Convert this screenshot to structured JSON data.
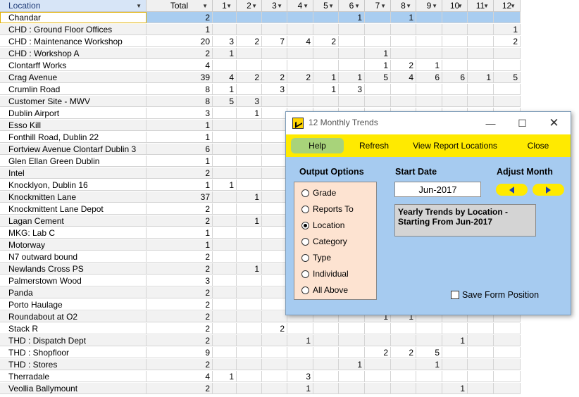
{
  "grid": {
    "columns": [
      "Location",
      "Total",
      "1",
      "2",
      "3",
      "4",
      "5",
      "6",
      "7",
      "8",
      "9",
      "10",
      "11",
      "12"
    ],
    "rows": [
      {
        "location": "Chandar",
        "total": "2",
        "m": [
          "",
          "",
          "",
          "",
          "",
          "1",
          "",
          "1",
          "",
          "",
          "",
          ""
        ]
      },
      {
        "location": "CHD : Ground Floor Offices",
        "total": "1",
        "m": [
          "",
          "",
          "",
          "",
          "",
          "",
          "",
          "",
          "",
          "",
          "",
          "1"
        ]
      },
      {
        "location": "CHD : Maintenance Workshop",
        "total": "20",
        "m": [
          "3",
          "2",
          "7",
          "4",
          "2",
          "",
          "",
          "",
          "",
          "",
          "",
          "2"
        ]
      },
      {
        "location": "CHD : Workshop A",
        "total": "2",
        "m": [
          "1",
          "",
          "",
          "",
          "",
          "",
          "1",
          "",
          "",
          "",
          "",
          ""
        ]
      },
      {
        "location": "Clontarff Works",
        "total": "4",
        "m": [
          "",
          "",
          "",
          "",
          "",
          "",
          "1",
          "2",
          "1",
          "",
          "",
          ""
        ]
      },
      {
        "location": "Crag Avenue",
        "total": "39",
        "m": [
          "4",
          "2",
          "2",
          "2",
          "1",
          "1",
          "5",
          "4",
          "6",
          "6",
          "1",
          "5"
        ]
      },
      {
        "location": "Crumlin Road",
        "total": "8",
        "m": [
          "1",
          "",
          "3",
          "",
          "1",
          "3",
          "",
          "",
          "",
          "",
          "",
          ""
        ]
      },
      {
        "location": "Customer Site - MWV",
        "total": "8",
        "m": [
          "5",
          "3",
          "",
          "",
          "",
          "",
          "",
          "",
          "",
          "",
          "",
          ""
        ]
      },
      {
        "location": "Dublin Airport",
        "total": "3",
        "m": [
          "",
          "1",
          "",
          "",
          "",
          "",
          "",
          "",
          "",
          "",
          "",
          ""
        ]
      },
      {
        "location": "Esso Kill",
        "total": "1",
        "m": [
          "",
          "",
          "",
          "",
          "",
          "",
          "",
          "",
          "",
          "",
          "",
          ""
        ]
      },
      {
        "location": "Fonthill Road, Dublin 22",
        "total": "1",
        "m": [
          "",
          "",
          "",
          "",
          "",
          "",
          "",
          "",
          "",
          "",
          "",
          ""
        ]
      },
      {
        "location": "Fortview Avenue Clontarf Dublin 3",
        "total": "6",
        "m": [
          "",
          "",
          "",
          "",
          "",
          "",
          "",
          "",
          "",
          "",
          "",
          ""
        ]
      },
      {
        "location": "Glen Ellan Green Dublin",
        "total": "1",
        "m": [
          "",
          "",
          "",
          "",
          "",
          "",
          "",
          "",
          "",
          "",
          "",
          ""
        ]
      },
      {
        "location": "Intel",
        "total": "2",
        "m": [
          "",
          "",
          "",
          "",
          "",
          "",
          "",
          "",
          "",
          "",
          "",
          ""
        ]
      },
      {
        "location": "Knocklyon, Dublin 16",
        "total": "1",
        "m": [
          "1",
          "",
          "",
          "",
          "",
          "",
          "",
          "",
          "",
          "",
          "",
          ""
        ]
      },
      {
        "location": "Knockmitten Lane",
        "total": "37",
        "m": [
          "",
          "1",
          "",
          "",
          "",
          "",
          "",
          "",
          "",
          "",
          "",
          ""
        ]
      },
      {
        "location": "Knockmittent Lane Depot",
        "total": "2",
        "m": [
          "",
          "",
          "",
          "",
          "",
          "",
          "",
          "",
          "",
          "",
          "",
          ""
        ]
      },
      {
        "location": "Lagan Cement",
        "total": "2",
        "m": [
          "",
          "1",
          "",
          "",
          "",
          "",
          "",
          "",
          "",
          "",
          "",
          ""
        ]
      },
      {
        "location": "MKG: Lab C",
        "total": "1",
        "m": [
          "",
          "",
          "",
          "",
          "",
          "",
          "",
          "",
          "",
          "",
          "",
          ""
        ]
      },
      {
        "location": "Motorway",
        "total": "1",
        "m": [
          "",
          "",
          "",
          "",
          "",
          "",
          "",
          "",
          "",
          "",
          "",
          ""
        ]
      },
      {
        "location": "N7 outward bound",
        "total": "2",
        "m": [
          "",
          "",
          "",
          "",
          "",
          "",
          "",
          "",
          "",
          "",
          "",
          ""
        ]
      },
      {
        "location": "Newlands Cross PS",
        "total": "2",
        "m": [
          "",
          "1",
          "",
          "",
          "",
          "",
          "",
          "",
          "",
          "",
          "",
          ""
        ]
      },
      {
        "location": "Palmerstown Wood",
        "total": "3",
        "m": [
          "",
          "",
          "",
          "",
          "",
          "",
          "",
          "",
          "",
          "",
          "",
          ""
        ]
      },
      {
        "location": "Panda",
        "total": "2",
        "m": [
          "",
          "",
          "",
          "",
          "",
          "",
          "",
          "",
          "",
          "",
          "",
          ""
        ]
      },
      {
        "location": "Porto Haulage",
        "total": "2",
        "m": [
          "",
          "",
          "",
          "",
          "",
          "",
          "",
          "",
          "",
          "",
          "",
          ""
        ]
      },
      {
        "location": "Roundabout at O2",
        "total": "2",
        "m": [
          "",
          "",
          "",
          "",
          "",
          "",
          "1",
          "1",
          "",
          "",
          "",
          ""
        ]
      },
      {
        "location": "Stack R",
        "total": "2",
        "m": [
          "",
          "",
          "2",
          "",
          "",
          "",
          "",
          "",
          "",
          "",
          "",
          ""
        ]
      },
      {
        "location": "THD : Dispatch Dept",
        "total": "2",
        "m": [
          "",
          "",
          "",
          "1",
          "",
          "",
          "",
          "",
          "",
          "1",
          "",
          ""
        ]
      },
      {
        "location": "THD : Shopfloor",
        "total": "9",
        "m": [
          "",
          "",
          "",
          "",
          "",
          "",
          "2",
          "2",
          "5",
          "",
          "",
          ""
        ]
      },
      {
        "location": "THD : Stores",
        "total": "2",
        "m": [
          "",
          "",
          "",
          "",
          "",
          "1",
          "",
          "",
          "1",
          "",
          "",
          ""
        ]
      },
      {
        "location": "Therradale",
        "total": "4",
        "m": [
          "1",
          "",
          "",
          "3",
          "",
          "",
          "",
          "",
          "",
          "",
          "",
          ""
        ]
      },
      {
        "location": "Veollia Ballymount",
        "total": "2",
        "m": [
          "",
          "",
          "",
          "1",
          "",
          "",
          "",
          "",
          "",
          "1",
          "",
          ""
        ]
      }
    ]
  },
  "dialog": {
    "title": "12 Monthly Trends",
    "toolbar": {
      "help": "Help",
      "refresh": "Refresh",
      "view": "View Report Locations",
      "close": "Close"
    },
    "output_options_label": "Output Options",
    "options": [
      "Grade",
      "Reports To",
      "Location",
      "Category",
      "Type",
      "Individual",
      "All Above"
    ],
    "selected_option": "Location",
    "start_date_label": "Start Date",
    "start_date": "Jun-2017",
    "adjust_month_label": "Adjust Month",
    "description": "Yearly Trends by Location - Starting From Jun-2017",
    "save_position_label": "Save Form Position"
  },
  "colors": {
    "toolbar": "#ffea00",
    "help_button": "#a8d37a",
    "dialog_bg": "#a6cbf0",
    "options_bg": "#fde3d1",
    "selected_row": "#a9cdf0"
  },
  "icons": {
    "prev": "triangle-left",
    "next": "triangle-right",
    "sort": "triangle-down"
  }
}
